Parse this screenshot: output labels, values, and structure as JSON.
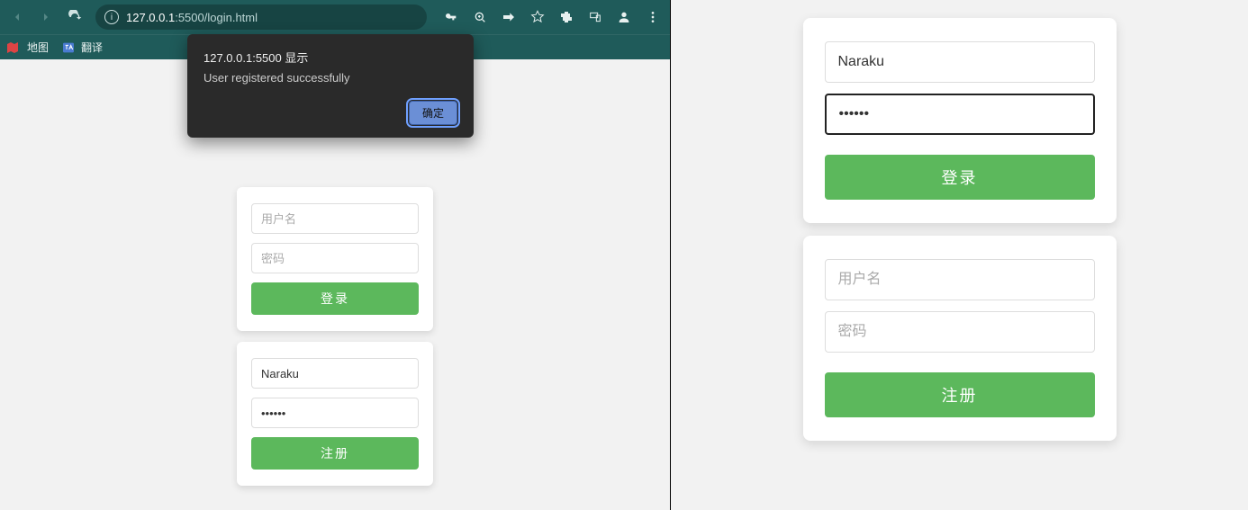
{
  "browser": {
    "url_host": "127.0.0.1",
    "url_rest": ":5500/login.html",
    "bookmarks": [
      {
        "label": "地图"
      },
      {
        "label": "翻译"
      }
    ]
  },
  "alert": {
    "title": "127.0.0.1:5500 显示",
    "message": "User registered successfully",
    "ok_label": "确定"
  },
  "left_login": {
    "username_placeholder": "用户名",
    "username_value": "",
    "password_placeholder": "密码",
    "password_value": "",
    "button_label": "登录"
  },
  "left_register": {
    "username_placeholder": "",
    "username_value": "Naraku",
    "password_placeholder": "",
    "password_value": "••••••",
    "button_label": "注册"
  },
  "right_login": {
    "username_placeholder": "",
    "username_value": "Naraku",
    "password_placeholder": "",
    "password_value": "••••••",
    "button_label": "登录"
  },
  "right_register": {
    "username_placeholder": "用户名",
    "username_value": "",
    "password_placeholder": "密码",
    "password_value": "",
    "button_label": "注册"
  }
}
